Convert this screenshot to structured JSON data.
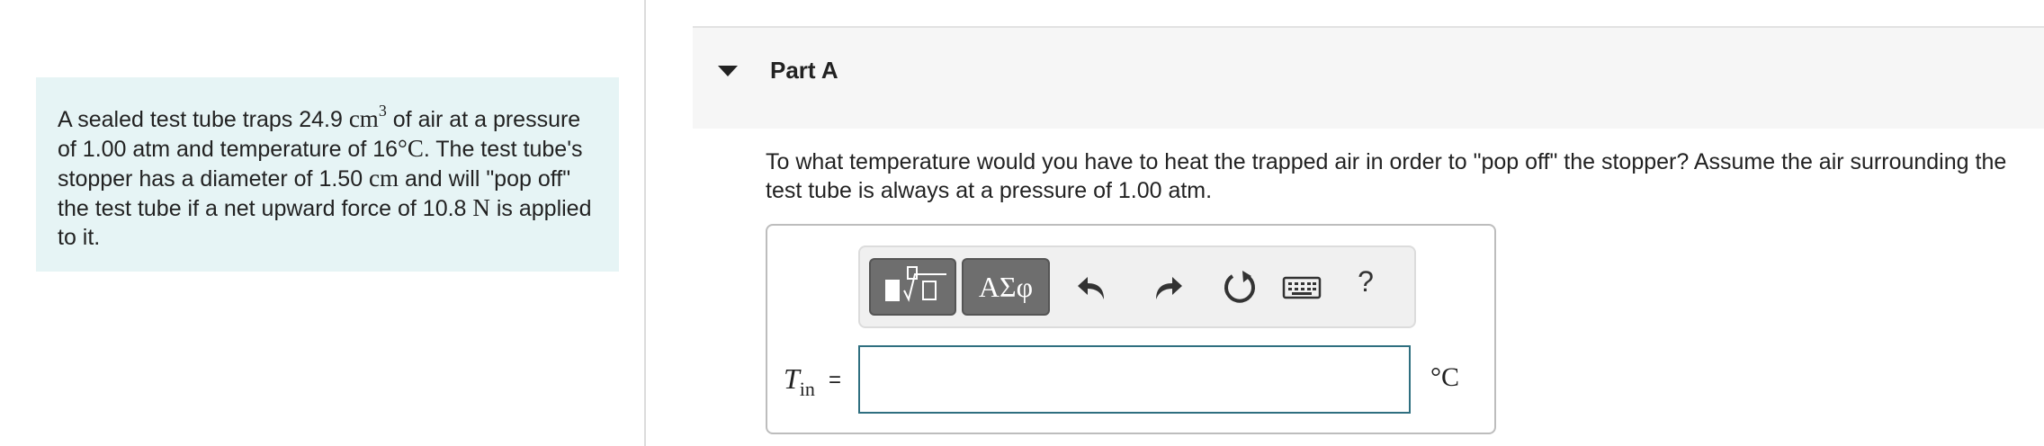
{
  "problem": {
    "t1": "A sealed test tube traps 24.9 ",
    "u1": "cm",
    "u1_exp": "3",
    "t2": " of air at a pressure of 1.00 atm and temperature of 16",
    "deg": "°",
    "u2": "C",
    "t3": ". The test tube's stopper has a diameter of 1.50 ",
    "u3": "cm",
    "t4": " and will \"pop off\" the test tube if a net upward force of 10.8 ",
    "u4": "N",
    "t5": " is applied to it."
  },
  "part": {
    "title": "Part A",
    "question": "To what temperature would you have to heat the trapped air in order to \"pop off\" the stopper? Assume the air surrounding the test tube is always at a pressure of 1.00 atm."
  },
  "toolbar": {
    "greek_label": "ΑΣφ",
    "help_label": "?",
    "icons": [
      "math-template-icon",
      "undo-icon",
      "redo-icon",
      "reset-icon",
      "keyboard-icon"
    ]
  },
  "answer": {
    "var_symbol": "T",
    "var_subscript": "in",
    "equals": "=",
    "value": "",
    "unit": "°C"
  },
  "colors": {
    "problem_bg": "#e6f4f5",
    "input_border": "#2f6f80",
    "template_button": "#6e6e6e",
    "header_bg": "#f6f6f6"
  }
}
